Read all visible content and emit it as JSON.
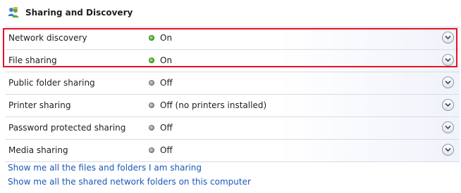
{
  "section": {
    "title": "Sharing and Discovery",
    "icon": "network-sharing-icon"
  },
  "rows": [
    {
      "label": "Network discovery",
      "status": "On",
      "state": "on"
    },
    {
      "label": "File sharing",
      "status": "On",
      "state": "on"
    },
    {
      "label": "Public folder sharing",
      "status": "Off",
      "state": "off"
    },
    {
      "label": "Printer sharing",
      "status": "Off (no printers installed)",
      "state": "off"
    },
    {
      "label": "Password protected sharing",
      "status": "Off",
      "state": "off"
    },
    {
      "label": "Media sharing",
      "status": "Off",
      "state": "off"
    }
  ],
  "links": [
    "Show me all the files and folders I am sharing",
    "Show me all the shared network folders on this computer"
  ],
  "colors": {
    "status_on": "#2f9d0f",
    "status_off": "#7b7b7b",
    "highlight": "#e81123",
    "link": "#1b58b8"
  }
}
